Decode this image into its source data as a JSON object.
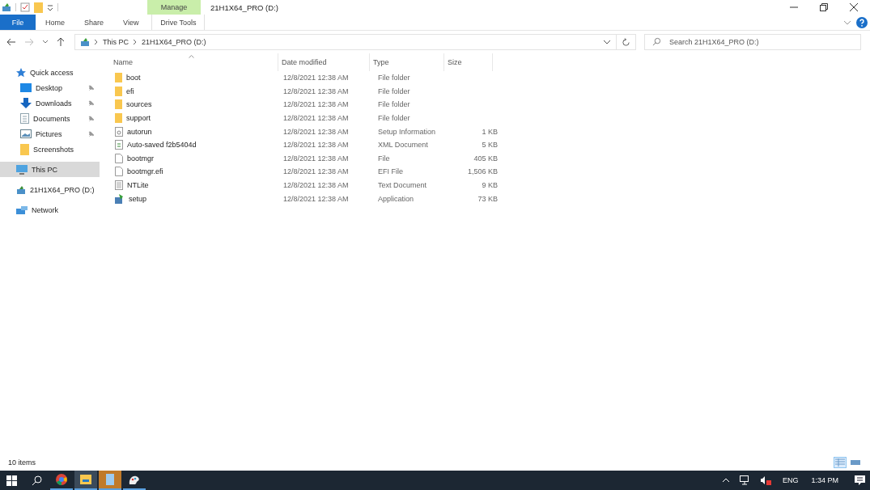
{
  "window": {
    "title": "21H1X64_PRO (D:)"
  },
  "ribbon": {
    "context_group": "Manage",
    "tabs": [
      {
        "label": "File",
        "kind": "file",
        "selected": false
      },
      {
        "label": "Home",
        "kind": "tab",
        "selected": false
      },
      {
        "label": "Share",
        "kind": "tab",
        "selected": false
      },
      {
        "label": "View",
        "kind": "tab",
        "selected": false
      },
      {
        "label": "Drive Tools",
        "kind": "context",
        "selected": false
      }
    ]
  },
  "address": {
    "breadcrumbs": [
      "This PC",
      "21H1X64_PRO (D:)"
    ]
  },
  "search": {
    "placeholder": "Search 21H1X64_PRO (D:)"
  },
  "sidebar": {
    "items": [
      {
        "label": "Quick access",
        "kind": "star",
        "selected": false,
        "children": [
          {
            "label": "Desktop",
            "kind": "desktop",
            "pinned": true,
            "selected": false
          },
          {
            "label": "Downloads",
            "kind": "download",
            "pinned": true,
            "selected": false
          },
          {
            "label": "Documents",
            "kind": "document",
            "pinned": true,
            "selected": false
          },
          {
            "label": "Pictures",
            "kind": "picture",
            "pinned": true,
            "selected": false
          },
          {
            "label": "Screenshots",
            "kind": "folder",
            "pinned": false,
            "selected": false
          }
        ]
      },
      {
        "label": "This PC",
        "kind": "pc",
        "selected": true
      },
      {
        "label": "21H1X64_PRO (D:)",
        "kind": "drive",
        "selected": false
      },
      {
        "label": "Network",
        "kind": "network",
        "selected": false
      }
    ]
  },
  "table": {
    "columns": [
      "Name",
      "Date modified",
      "Type",
      "Size"
    ],
    "rows": [
      {
        "name": "boot",
        "kind": "folder",
        "date": "12/8/2021 12:38 AM",
        "type": "File folder"
      },
      {
        "name": "efi",
        "kind": "folder",
        "date": "12/8/2021 12:38 AM",
        "type": "File folder"
      },
      {
        "name": "sources",
        "kind": "folder",
        "date": "12/8/2021 12:38 AM",
        "type": "File folder"
      },
      {
        "name": "support",
        "kind": "folder",
        "date": "12/8/2021 12:38 AM",
        "type": "File folder"
      },
      {
        "name": "autorun",
        "kind": "settings",
        "date": "12/8/2021 12:38 AM",
        "type": "Setup Information",
        "size": "1 KB"
      },
      {
        "name": "Auto-saved f2b5404d",
        "kind": "xml",
        "date": "12/8/2021 12:38 AM",
        "type": "XML Document",
        "size": "5 KB"
      },
      {
        "name": "bootmgr",
        "kind": "file",
        "date": "12/8/2021 12:38 AM",
        "type": "File",
        "size": "405 KB"
      },
      {
        "name": "bootmgr.efi",
        "kind": "file",
        "date": "12/8/2021 12:38 AM",
        "type": "EFI File",
        "size": "1,506 KB"
      },
      {
        "name": "NTLite",
        "kind": "text",
        "date": "12/8/2021 12:38 AM",
        "type": "Text Document",
        "size": "9 KB"
      },
      {
        "name": "setup",
        "kind": "app",
        "date": "12/8/2021 12:38 AM",
        "type": "Application",
        "size": "73 KB"
      }
    ]
  },
  "status_bar": {
    "text": "10 items",
    "views": [
      {
        "kind": "details",
        "selected": true
      },
      {
        "kind": "tiles",
        "selected": false
      }
    ]
  },
  "taskbar": {
    "apps": [
      {
        "kind": "browser",
        "active": false
      },
      {
        "kind": "explorer",
        "active": true
      },
      {
        "kind": "notepad",
        "active": true
      },
      {
        "kind": "paint",
        "active": false
      }
    ],
    "language": "ENG",
    "time": "1:34 PM"
  }
}
